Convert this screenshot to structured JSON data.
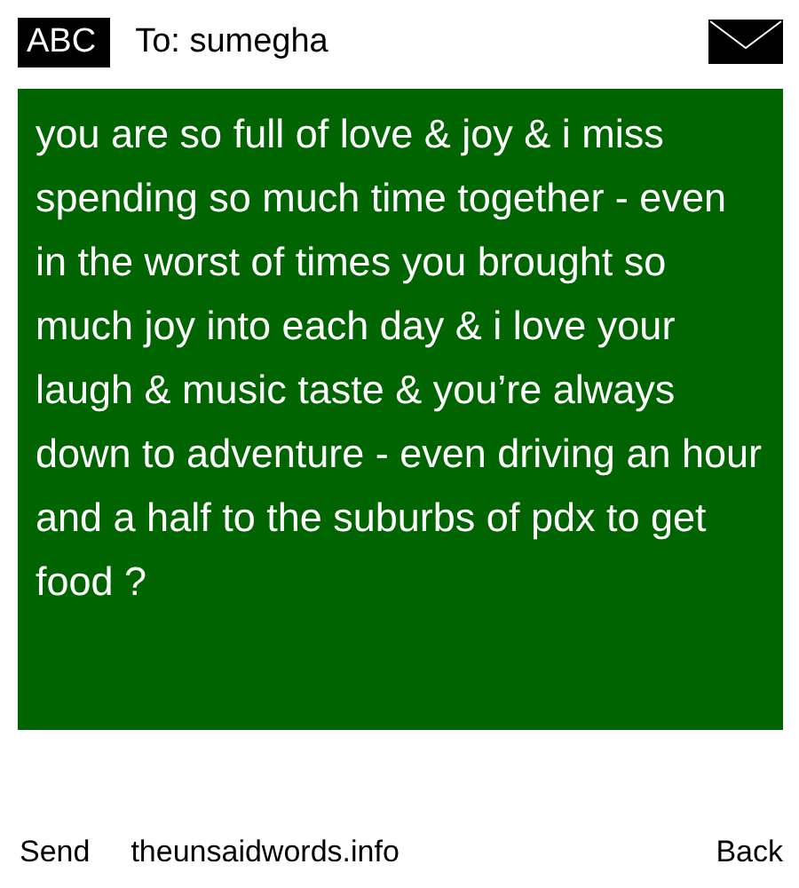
{
  "header": {
    "mode": "ABC",
    "recipient": "To: sumegha"
  },
  "message": "you are so full of love & joy & i miss spending so much time together - even in the worst of times you brought so much joy into each day & i love your laugh & music taste & you’re always down to adventure - even driving an hour and a half to the suburbs of pdx to get food ?",
  "footer": {
    "left": "Send",
    "site": "theunsaidwords.info",
    "right": "Back"
  }
}
